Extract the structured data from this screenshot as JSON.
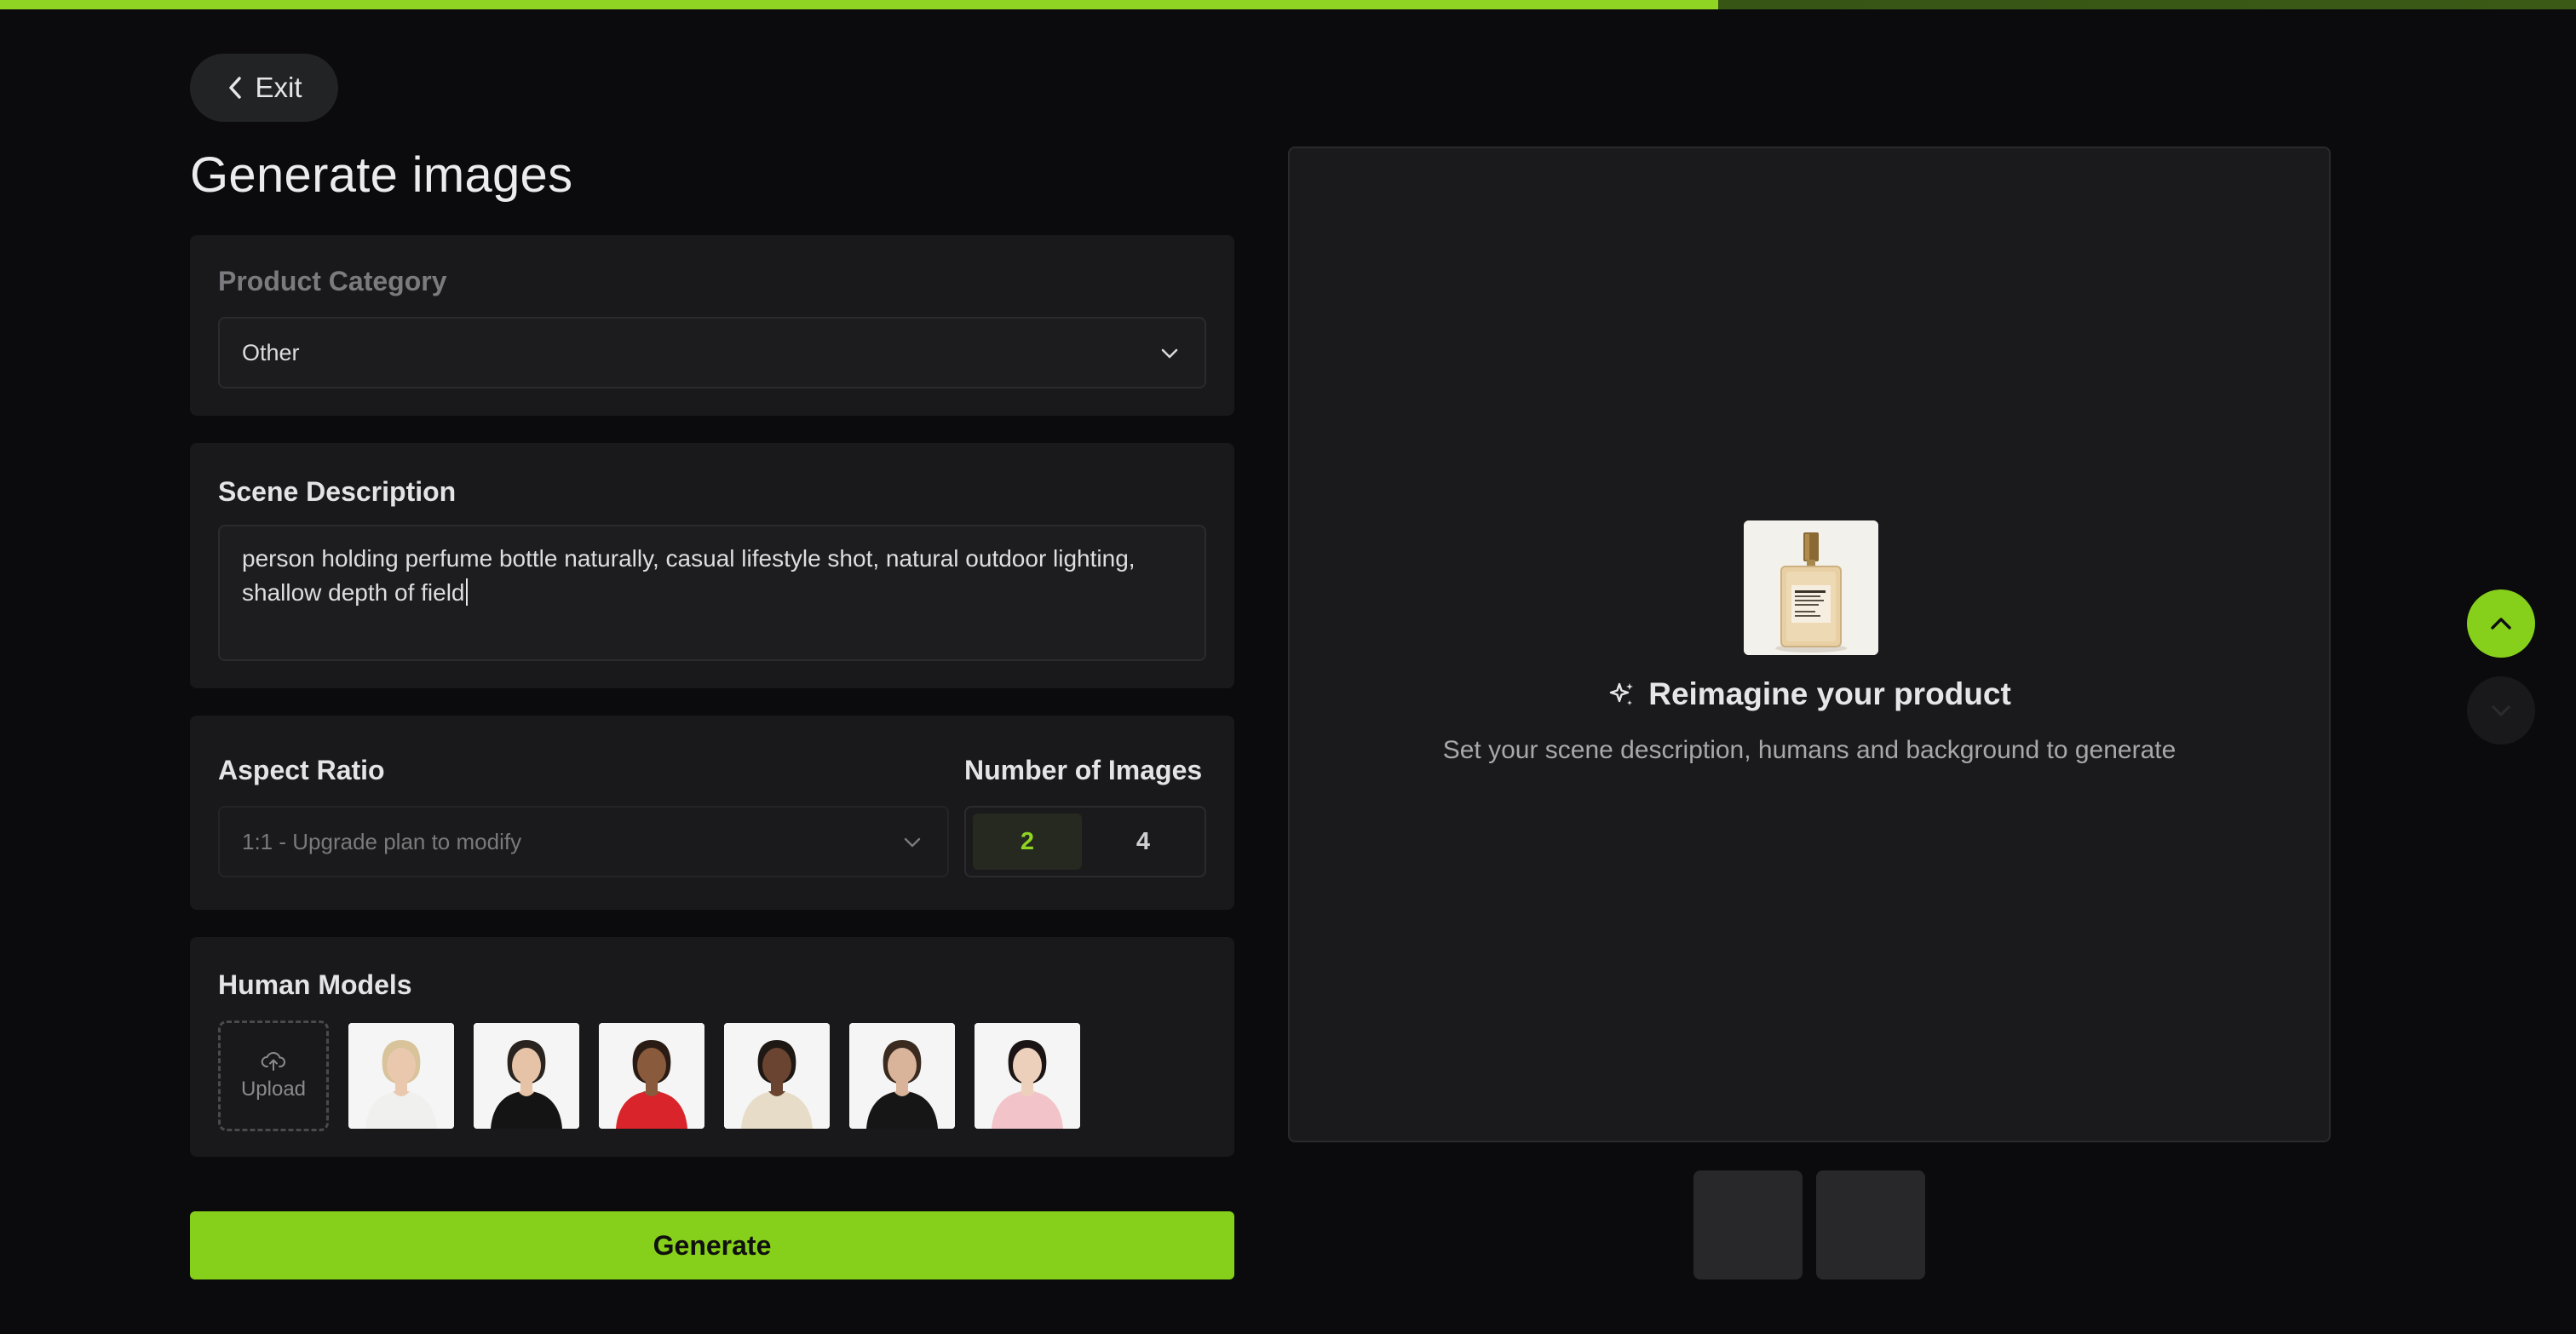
{
  "progress": {
    "fraction": 0.667,
    "fill_color": "#8fd422"
  },
  "header": {
    "exit_label": "Exit",
    "title": "Generate images"
  },
  "product_category": {
    "label": "Product Category",
    "selected": "Other"
  },
  "scene_description": {
    "label": "Scene Description",
    "value": "person holding perfume bottle naturally, casual lifestyle shot, natural outdoor lighting, shallow depth of field"
  },
  "aspect_ratio": {
    "label": "Aspect Ratio",
    "selected": "1:1 - Upgrade plan to modify"
  },
  "number_of_images": {
    "label": "Number of Images",
    "options": [
      "2",
      "4"
    ],
    "selected": "2"
  },
  "human_models": {
    "label": "Human Models",
    "upload_label": "Upload",
    "models": [
      {
        "name": "model-1",
        "skin": "#e9c8ae",
        "hair": "#d8c39a",
        "top": "#f0f0ee"
      },
      {
        "name": "model-2",
        "skin": "#e6c3a6",
        "hair": "#2a2420",
        "top": "#141414"
      },
      {
        "name": "model-3",
        "skin": "#8a5a3c",
        "hair": "#2a1c14",
        "top": "#d8242a"
      },
      {
        "name": "model-4",
        "skin": "#6a4430",
        "hair": "#1e1814",
        "top": "#e6dcc8"
      },
      {
        "name": "model-5",
        "skin": "#d9b49a",
        "hair": "#3a2a20",
        "top": "#161616"
      },
      {
        "name": "model-6",
        "skin": "#edd0bc",
        "hair": "#1a1414",
        "top": "#f2c3c8"
      }
    ]
  },
  "generate_label": "Generate",
  "preview": {
    "title": "Reimagine your product",
    "subtitle": "Set your scene description, humans and background to generate"
  },
  "colors": {
    "accent": "#86cf1a",
    "background": "#0b0b0d",
    "panel": "#19191b"
  }
}
